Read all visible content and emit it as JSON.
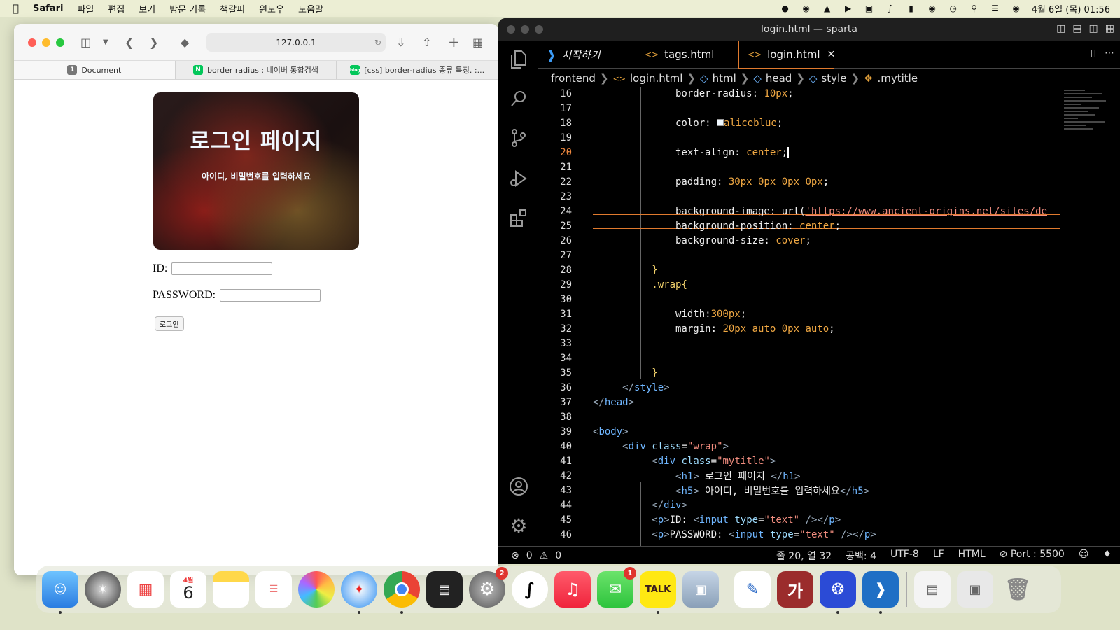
{
  "menubar": {
    "app": "Safari",
    "items": [
      "파일",
      "편집",
      "보기",
      "방문 기록",
      "책갈피",
      "윈도우",
      "도움말"
    ],
    "datetime": "4월 6일 (목) 01:56"
  },
  "safari": {
    "url": "127.0.0.1",
    "tabs": [
      {
        "label": "Document",
        "favicon": "1"
      },
      {
        "label": "border radius : 네이버 통합검색",
        "favicon": "N"
      },
      {
        "label": "[css] border-radius 종류 특징. :...",
        "favicon": "blog"
      }
    ],
    "page": {
      "title": "로그인 페이지",
      "subtitle": "아이디, 비밀번호를 입력하세요",
      "id_label": "ID:",
      "password_label": "PASSWORD:",
      "login_button": "로그인"
    }
  },
  "vscode": {
    "window_title": "login.html — sparta",
    "tabs": [
      {
        "label": "시작하기"
      },
      {
        "label": "tags.html"
      },
      {
        "label": "login.html",
        "active": true
      }
    ],
    "breadcrumb": [
      "frontend",
      "login.html",
      "html",
      "head",
      "style",
      ".mytitle"
    ],
    "current_line": "20",
    "status": {
      "errors": "0",
      "warnings": "0",
      "position": "줄 20, 열 32",
      "spaces": "공백: 4",
      "encoding": "UTF-8",
      "eol": "LF",
      "language": "HTML",
      "port": "Port : 5500"
    }
  },
  "dock": {
    "calendar_month": "4월",
    "calendar_day": "6",
    "settings_badge": "2",
    "messages_badge": "1",
    "kakaotalk_label": "TALK",
    "dictionary_label": "가"
  }
}
